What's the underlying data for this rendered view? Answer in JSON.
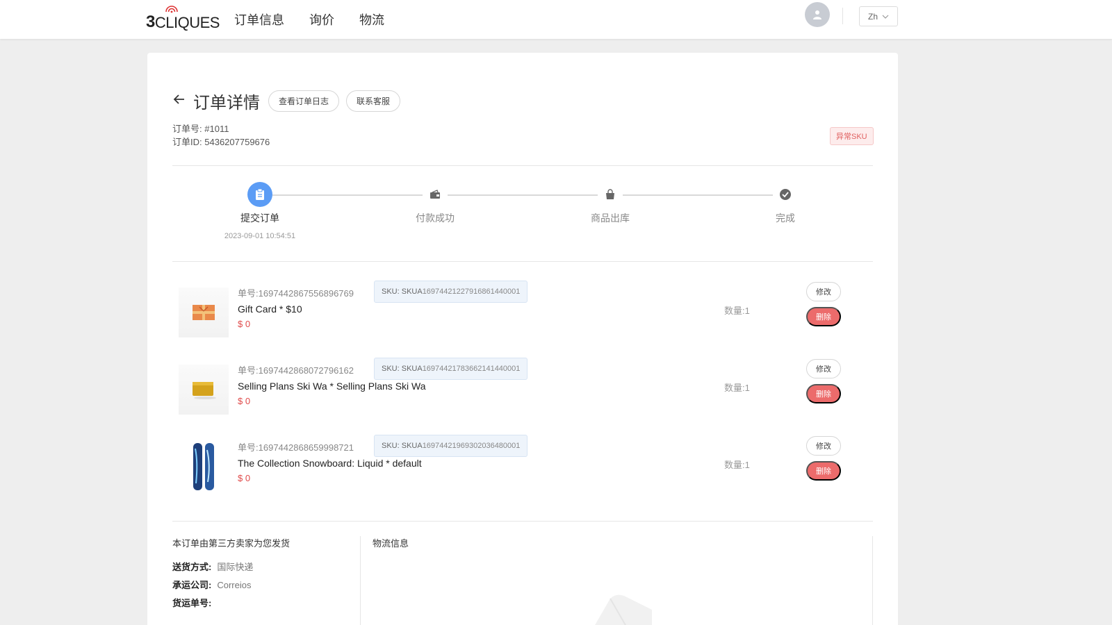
{
  "header": {
    "logo_num": "3",
    "logo_text": "CLIQUES",
    "nav": [
      "订单信息",
      "询价",
      "物流"
    ],
    "lang": "Zh"
  },
  "order": {
    "back_icon": "arrow-left-icon",
    "title": "订单详情",
    "btn_log": "查看订单日志",
    "btn_service": "联系客服",
    "order_no_label": "订单号:",
    "order_no": "#1011",
    "order_id_label": "订单ID:",
    "order_id": "5436207759676",
    "abnormal_badge": "异常SKU"
  },
  "steps": [
    {
      "label": "提交订单",
      "time": "2023-09-01 10:54:51",
      "icon": "clipboard-icon",
      "active": true
    },
    {
      "label": "付款成功",
      "time": "",
      "icon": "wallet-icon",
      "active": false
    },
    {
      "label": "商品出库",
      "time": "",
      "icon": "bag-icon",
      "active": false
    },
    {
      "label": "完成",
      "time": "",
      "icon": "check-circle-icon",
      "active": false
    }
  ],
  "items": [
    {
      "order_label": "单号:",
      "order_no": "1697442867556896769",
      "sku_label": "SKU: SKUA",
      "sku_code": "1697442122791686144000​1",
      "name": "Gift Card * $10",
      "price": "$ 0",
      "qty": "数量:1",
      "edit": "修改",
      "delete": "删除",
      "thumb": "gift-card-thumb"
    },
    {
      "order_label": "单号:",
      "order_no": "1697442868072796162",
      "sku_label": "SKU: SKUA",
      "sku_code": "16974421783662141440001",
      "name": "Selling Plans Ski Wa * Selling Plans Ski Wa",
      "price": "$ 0",
      "qty": "数量:1",
      "edit": "修改",
      "delete": "删除",
      "thumb": "ski-wax-thumb"
    },
    {
      "order_label": "单号:",
      "order_no": "1697442868659998721",
      "sku_label": "SKU: SKUA",
      "sku_code": "16974421969302036480001",
      "name": "The Collection Snowboard: Liquid * default",
      "price": "$ 0",
      "qty": "数量:1",
      "edit": "修改",
      "delete": "删除",
      "thumb": "snowboard-thumb"
    }
  ],
  "shipping": {
    "title": "本订单由第三方卖家为您发货",
    "method_label": "送货方式:",
    "method": "国际快递",
    "carrier_label": "承运公司:",
    "carrier": "Correios",
    "tracking_label": "货运单号:",
    "tracking": ""
  },
  "logistics": {
    "title": "物流信息"
  },
  "colors": {
    "accent": "#5b9cf5",
    "danger": "#ec6b6b",
    "price": "#e04a4a"
  }
}
